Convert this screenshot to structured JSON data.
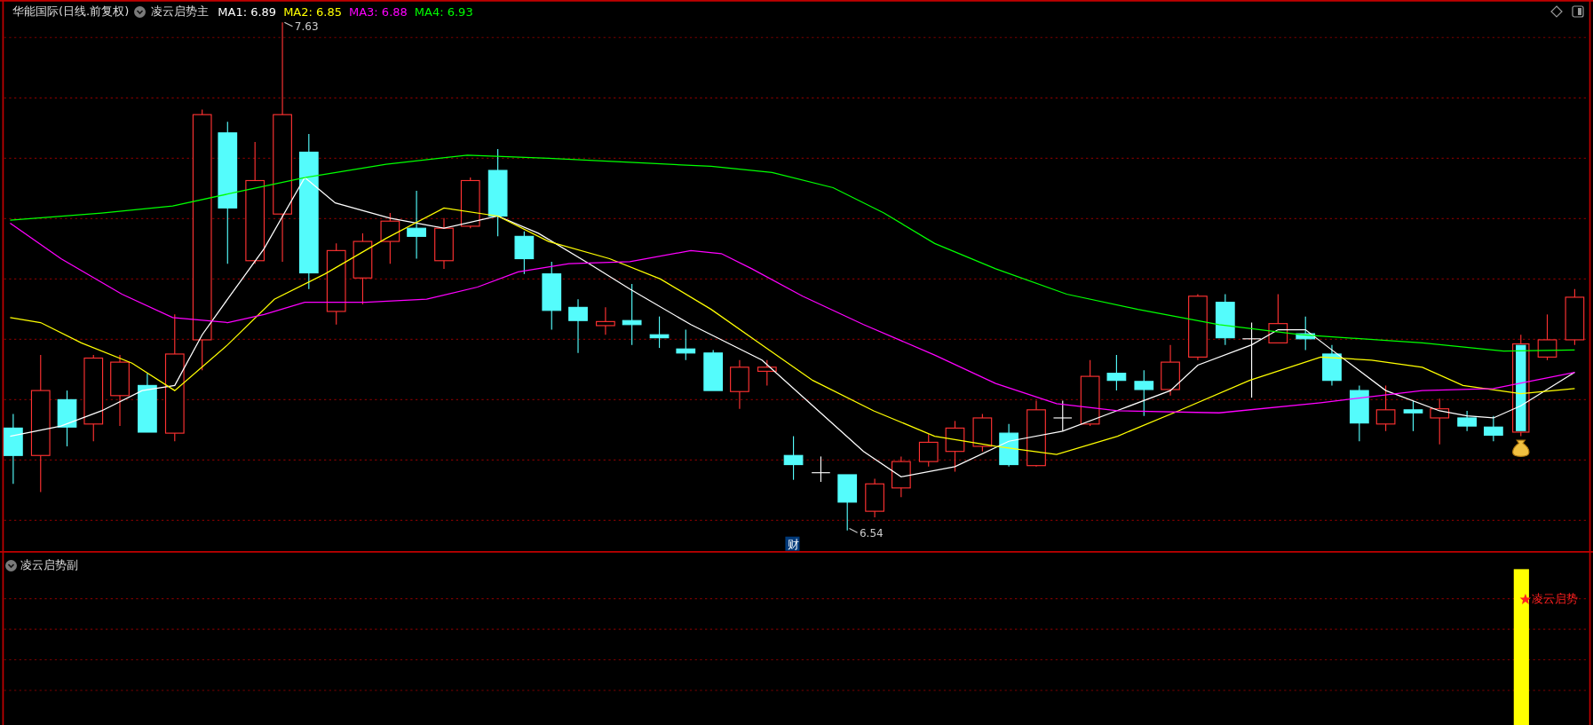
{
  "main_panel": {
    "title": "华能国际(日线.前复权)",
    "indicator": "凌云启势主",
    "ma_legend": [
      {
        "label": "MA1: 6.89",
        "color": "#ffffff"
      },
      {
        "label": "MA2: 6.85",
        "color": "#ffff00"
      },
      {
        "label": "MA3: 6.88",
        "color": "#ff00ff"
      },
      {
        "label": "MA4: 6.93",
        "color": "#00ff00"
      }
    ],
    "high_label": "7.63",
    "low_label": "6.54",
    "marker_badge": "财"
  },
  "sub_panel": {
    "indicator": "凌云启势副",
    "signal_label": "凌云启势"
  }
}
